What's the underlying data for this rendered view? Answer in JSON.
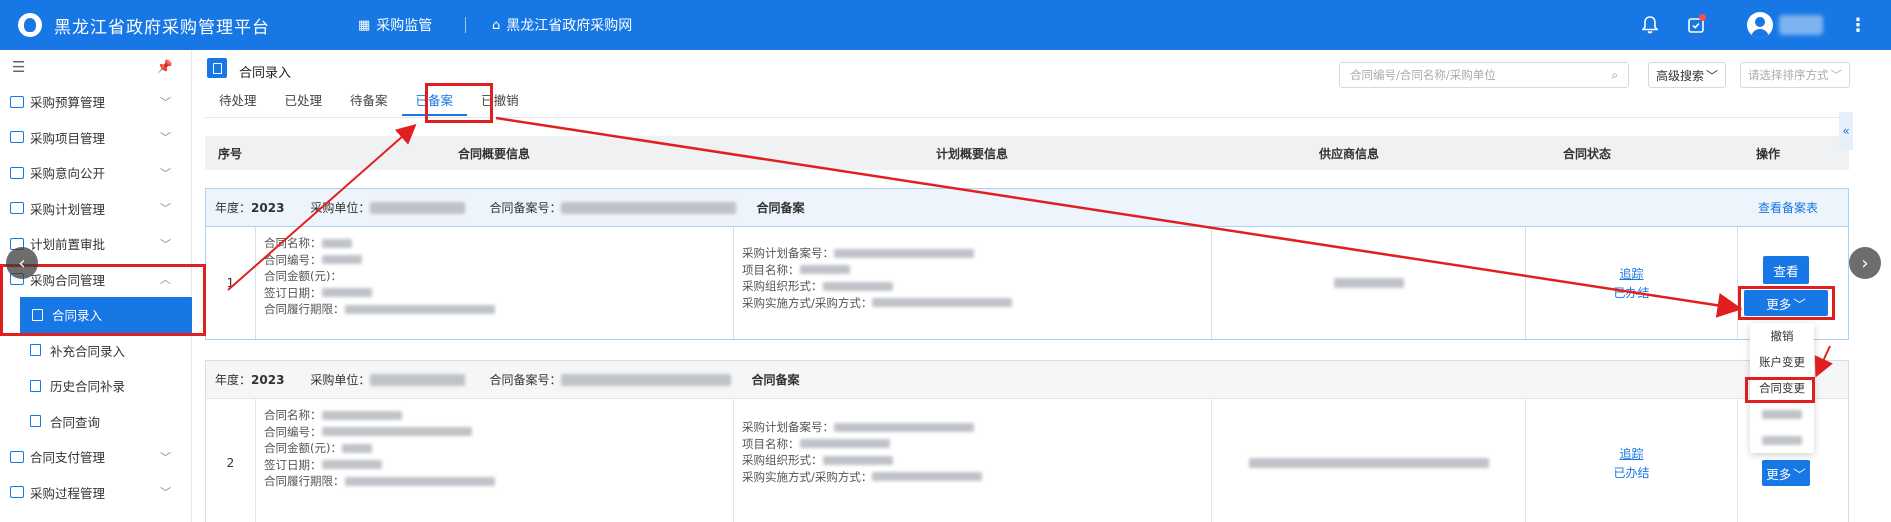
{
  "topbar": {
    "app_title": "黑龙江省政府采购管理平台",
    "nav_supervision": "采购监管",
    "nav_website": "黑龙江省政府采购网"
  },
  "sidebar": {
    "items": [
      {
        "label": "采购预算管理"
      },
      {
        "label": "采购项目管理"
      },
      {
        "label": "采购意向公开"
      },
      {
        "label": "采购计划管理"
      },
      {
        "label": "计划前置审批"
      },
      {
        "label": "采购合同管理"
      },
      {
        "label": "合同支付管理"
      },
      {
        "label": "采购过程管理"
      }
    ],
    "subitems": [
      {
        "label": "合同录入"
      },
      {
        "label": "补充合同录入"
      },
      {
        "label": "历史合同补录"
      },
      {
        "label": "合同查询"
      }
    ]
  },
  "page": {
    "title": "合同录入",
    "tabs": [
      "待处理",
      "已处理",
      "待备案",
      "已备案",
      "已撤销"
    ],
    "active_tab": "已备案",
    "search_placeholder": "合同编号/合同名称/采购单位",
    "advanced_search": "高级搜索",
    "sort_placeholder": "请选择排序方式"
  },
  "table": {
    "headers": [
      "序号",
      "合同概要信息",
      "计划概要信息",
      "供应商信息",
      "合同状态",
      "操作"
    ],
    "groups": [
      {
        "year_label": "年度：",
        "year": "2023",
        "unit_label": "采购单位：",
        "record_label": "合同备案号：",
        "tag": "合同备案",
        "view_record": "查看备案表",
        "index": "1",
        "contract_fields": [
          "合同名称：",
          "合同编号：",
          "合同金额(元)：",
          "签订日期：",
          "合同履行期限："
        ],
        "plan_fields": [
          "采购计划备案号：",
          "项目名称：",
          "采购组织形式：",
          "采购实施方式/采购方式："
        ],
        "status_link": "追踪",
        "status_text": "已办结",
        "op_view": "查看",
        "op_more": "更多"
      },
      {
        "year_label": "年度：",
        "year": "2023",
        "unit_label": "采购单位：",
        "record_label": "合同备案号：",
        "tag": "合同备案",
        "index": "2",
        "contract_fields": [
          "合同名称：",
          "合同编号：",
          "合同金额(元)：",
          "签订日期：",
          "合同履行期限："
        ],
        "plan_fields": [
          "采购计划备案号：",
          "项目名称：",
          "采购组织形式：",
          "采购实施方式/采购方式："
        ],
        "status_link": "追踪",
        "status_text": "已办结",
        "op_more": "更多"
      }
    ]
  },
  "dropdown": {
    "items": [
      "撤销",
      "账户变更",
      "合同变更"
    ]
  },
  "colors": {
    "brand": "#1677e5",
    "annotation": "#e02020"
  }
}
